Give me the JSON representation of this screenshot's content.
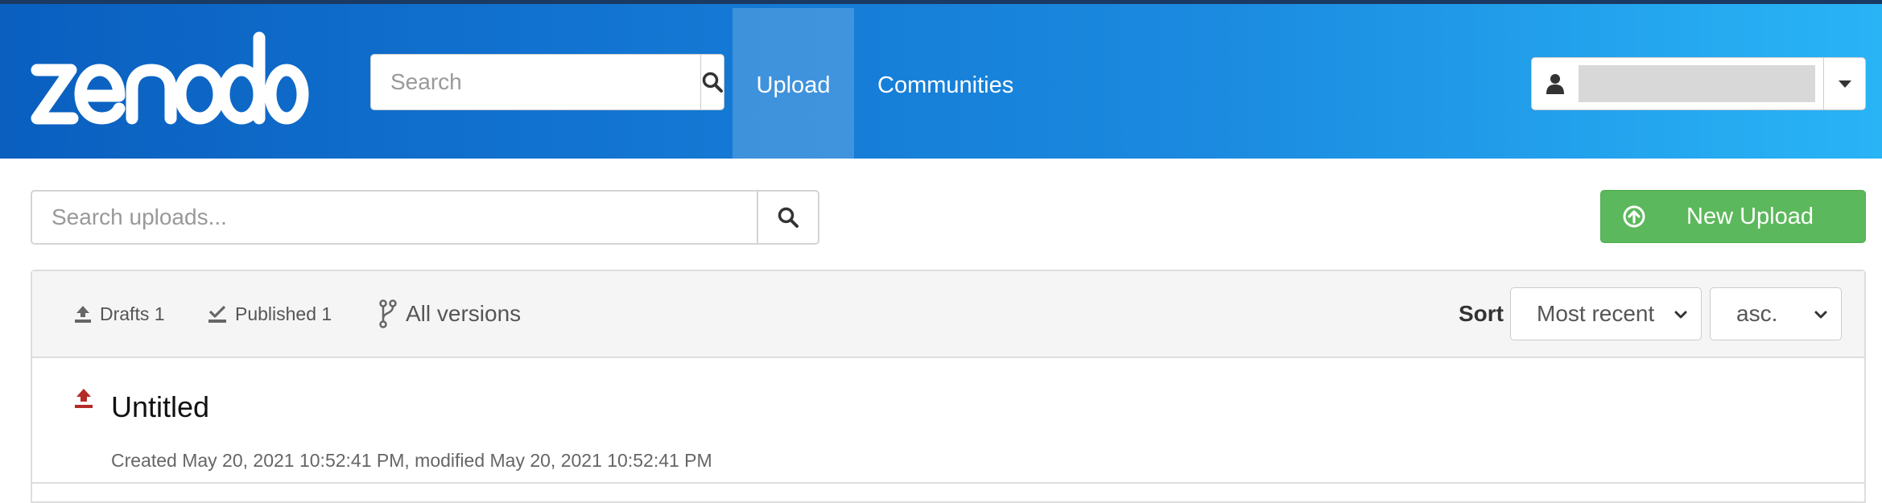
{
  "navbar": {
    "logo_text": "zenodo",
    "search_placeholder": "Search",
    "links": [
      {
        "label": "Upload",
        "active": true
      },
      {
        "label": "Communities",
        "active": false
      }
    ],
    "user": {
      "name_redacted": true
    },
    "colors": {
      "gradient_start": "#0a5fbf",
      "gradient_end": "#29b4f6"
    }
  },
  "toolbar": {
    "search_placeholder": "Search uploads...",
    "new_upload_label": "New Upload",
    "new_upload_color": "#5cb85c"
  },
  "filters": {
    "drafts": "Drafts 1",
    "published": "Published 1",
    "all_versions": "All versions"
  },
  "sort": {
    "label": "Sort",
    "field": "Most recent",
    "order": "asc."
  },
  "uploads": [
    {
      "title": "Untitled",
      "status_icon": "upload-draft-icon",
      "status_color": "#b52b27",
      "meta": "Created May 20, 2021 10:52:41 PM, modified May 20, 2021 10:52:41 PM"
    }
  ]
}
